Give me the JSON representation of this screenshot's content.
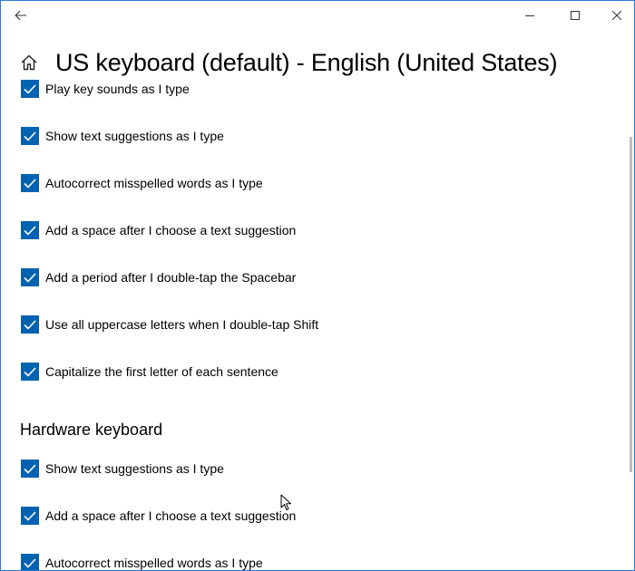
{
  "window": {
    "title": "US keyboard (default) - English (United States)"
  },
  "touch_keyboard": {
    "items": [
      {
        "label": "Play key sounds as I type",
        "checked": true
      },
      {
        "label": "Show text suggestions as I type",
        "checked": true
      },
      {
        "label": "Autocorrect misspelled words as I type",
        "checked": true
      },
      {
        "label": "Add a space after I choose a text suggestion",
        "checked": true
      },
      {
        "label": "Add a period after I double-tap the Spacebar",
        "checked": true
      },
      {
        "label": "Use all uppercase letters when I double-tap Shift",
        "checked": true
      },
      {
        "label": "Capitalize the first letter of each sentence",
        "checked": true
      }
    ]
  },
  "hardware_keyboard": {
    "heading": "Hardware keyboard",
    "items": [
      {
        "label": "Show text suggestions as I type",
        "checked": true
      },
      {
        "label": "Add a space after I choose a text suggestion",
        "checked": true
      },
      {
        "label": "Autocorrect misspelled words as I type",
        "checked": true
      }
    ]
  },
  "icons": {
    "back": "back-arrow-icon",
    "home": "home-icon",
    "minimize": "minimize-icon",
    "maximize": "maximize-icon",
    "close": "close-icon",
    "checkmark": "checkmark-icon"
  },
  "colors": {
    "accent": "#0063b1",
    "window_border": "#2b79d4"
  }
}
